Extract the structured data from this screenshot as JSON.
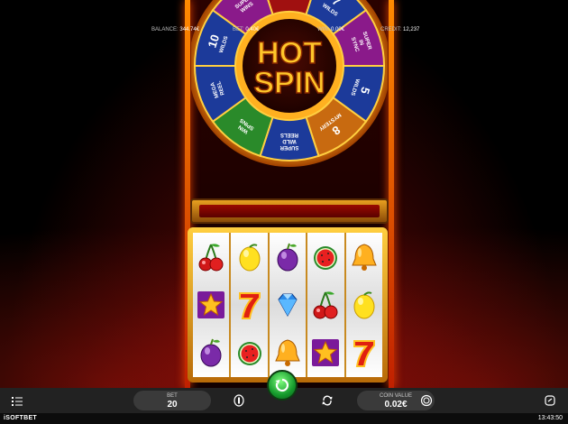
{
  "wheel": {
    "title_line1": "HOT",
    "title_line2": "SPIN",
    "segments": [
      {
        "number": "9",
        "text": "MYSTERY"
      },
      {
        "number": "7",
        "text": "WILDS"
      },
      {
        "number": "",
        "text": "SUPER IN SYNC"
      },
      {
        "number": "5",
        "text": "WILDS"
      },
      {
        "number": "8",
        "text": "MYSTERY"
      },
      {
        "number": "",
        "text": "SUPER WILD REELS"
      },
      {
        "number": "",
        "text": "WIN SPINS"
      },
      {
        "number": "",
        "text": "MEGA REEL"
      },
      {
        "number": "10",
        "text": "WILDS"
      },
      {
        "number": "",
        "text": "SUPER WINS"
      }
    ]
  },
  "reels": [
    [
      "cherry",
      "star",
      "plum"
    ],
    [
      "lemon",
      "seven",
      "watermelon"
    ],
    [
      "plum",
      "diamond",
      "bell"
    ],
    [
      "watermelon",
      "cherry",
      "star"
    ],
    [
      "bell",
      "lemon",
      "seven"
    ]
  ],
  "controls": {
    "bet_label": "BET",
    "bet_value": "20",
    "coin_label": "COIN VALUE",
    "coin_value": "0.02€"
  },
  "status": {
    "balance_label": "BALANCE:",
    "balance_value": "344.74€",
    "bet_label": "BET:",
    "bet_value": "0.40€",
    "win_label": "WIN:",
    "win_value": "0.00€",
    "credit_label": "CREDIT:",
    "credit_value": "12,237",
    "time": "13:43:50"
  },
  "brand": {
    "logo_text": "iSOFTBET"
  },
  "colors": {
    "spin_button": "#1fa83a",
    "frame_gold": "#e8a020",
    "background_red": "#7a0a06"
  }
}
